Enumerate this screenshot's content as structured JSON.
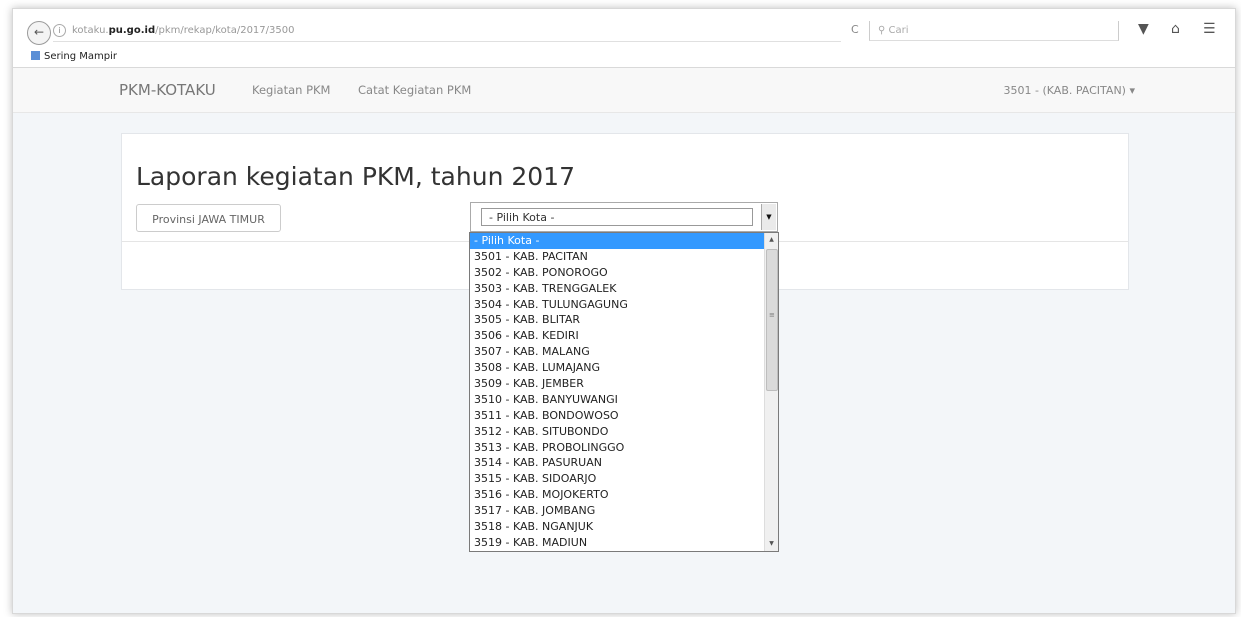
{
  "browser": {
    "url_prefix": "kotaku.",
    "url_host": "pu.go.id",
    "url_path": "/pkm/rekap/kota/2017/3500",
    "search_placeholder": "Cari",
    "reload_glyph": "C",
    "bookmarks_label": "Sering Mampir"
  },
  "navbar": {
    "brand": "PKM-KOTAKU",
    "links": [
      "Kegiatan PKM",
      "Catat Kegiatan PKM"
    ],
    "user_menu": "3501 - (KAB. PACITAN)"
  },
  "panel": {
    "title": "Laporan kegiatan PKM, tahun 2017",
    "province_button": "Provinsi JAWA TIMUR",
    "city_select_value": "- Pilih Kota -"
  },
  "dropdown": {
    "options": [
      "- Pilih Kota -",
      "3501 - KAB. PACITAN",
      "3502 - KAB. PONOROGO",
      "3503 - KAB. TRENGGALEK",
      "3504 - KAB. TULUNGAGUNG",
      "3505 - KAB. BLITAR",
      "3506 - KAB. KEDIRI",
      "3507 - KAB. MALANG",
      "3508 - KAB. LUMAJANG",
      "3509 - KAB. JEMBER",
      "3510 - KAB. BANYUWANGI",
      "3511 - KAB. BONDOWOSO",
      "3512 - KAB. SITUBONDO",
      "3513 - KAB. PROBOLINGGO",
      "3514 - KAB. PASURUAN",
      "3515 - KAB. SIDOARJO",
      "3516 - KAB. MOJOKERTO",
      "3517 - KAB. JOMBANG",
      "3518 - KAB. NGANJUK",
      "3519 - KAB. MADIUN"
    ],
    "selected_index": 0
  }
}
